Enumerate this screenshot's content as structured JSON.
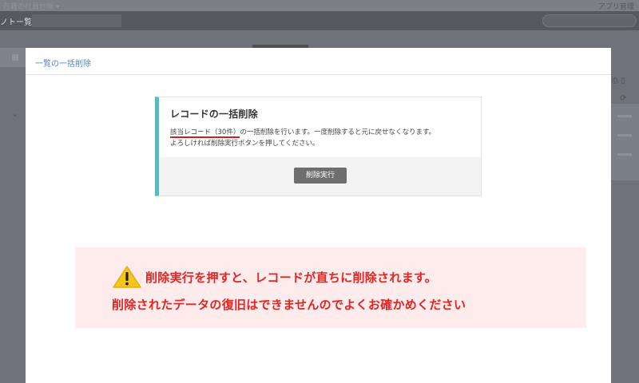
{
  "background": {
    "topbar_left": "在籍の社員台帳 ▾",
    "topbar_right": "アプリ管理",
    "nav_left": "ノトー覧",
    "chevron": "⌄",
    "right_icons": "⎙ ▯",
    "right_icons2": "⟳"
  },
  "modal": {
    "title": "一覧の一括削除",
    "card": {
      "heading": "レコードの一括削除",
      "desc_target": "該当レコード（30件）",
      "desc_rest": "の一括削除を行います。一度削除すると元に戻せなくなります。",
      "desc_line2": "よろしければ削除実行ボタンを押してください。",
      "execute_button": "削除実行"
    },
    "warning": {
      "line1": "削除実行を押すと、レコードが直ちに削除されます。",
      "line2": "削除されたデータの復旧はできませんのでよくお確かめください",
      "icon": "warning-triangle"
    }
  },
  "colors": {
    "accent_teal": "#5fb8bd",
    "warning_red": "#e32424",
    "warning_bg": "#fdeceb",
    "title_blue": "#5a86c8",
    "button_gray": "#6e6e6e"
  }
}
